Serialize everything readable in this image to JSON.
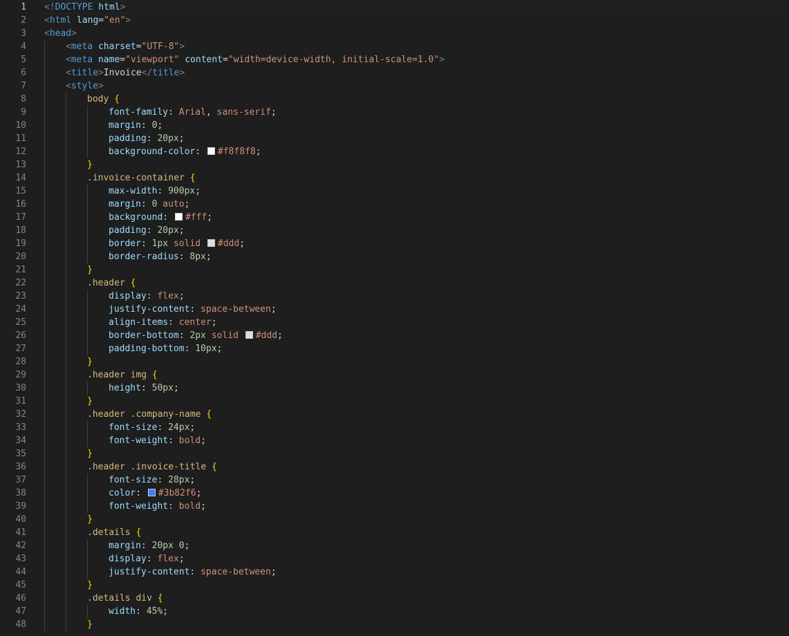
{
  "editor": {
    "current_line": 1,
    "lines": [
      {
        "n": "1",
        "indent": 0,
        "tokens": [
          {
            "t": "<!",
            "c": "punc"
          },
          {
            "t": "DOCTYPE",
            "c": "doctype"
          },
          {
            "t": " html",
            "c": "attr"
          },
          {
            "t": ">",
            "c": "punc"
          }
        ]
      },
      {
        "n": "2",
        "indent": 0,
        "tokens": [
          {
            "t": "<",
            "c": "punc"
          },
          {
            "t": "html",
            "c": "tag"
          },
          {
            "t": " lang",
            "c": "attr"
          },
          {
            "t": "=",
            "c": "plain"
          },
          {
            "t": "\"en\"",
            "c": "str"
          },
          {
            "t": ">",
            "c": "punc"
          }
        ]
      },
      {
        "n": "3",
        "indent": 0,
        "tokens": [
          {
            "t": "<",
            "c": "punc"
          },
          {
            "t": "head",
            "c": "tag"
          },
          {
            "t": ">",
            "c": "punc"
          }
        ]
      },
      {
        "n": "4",
        "indent": 1,
        "tokens": [
          {
            "t": "<",
            "c": "punc"
          },
          {
            "t": "meta",
            "c": "tag"
          },
          {
            "t": " charset",
            "c": "attr"
          },
          {
            "t": "=",
            "c": "plain"
          },
          {
            "t": "\"UTF-8\"",
            "c": "str"
          },
          {
            "t": ">",
            "c": "punc"
          }
        ]
      },
      {
        "n": "5",
        "indent": 1,
        "tokens": [
          {
            "t": "<",
            "c": "punc"
          },
          {
            "t": "meta",
            "c": "tag"
          },
          {
            "t": " name",
            "c": "attr"
          },
          {
            "t": "=",
            "c": "plain"
          },
          {
            "t": "\"viewport\"",
            "c": "str"
          },
          {
            "t": " content",
            "c": "attr"
          },
          {
            "t": "=",
            "c": "plain"
          },
          {
            "t": "\"width=device-width, initial-scale=1.0\"",
            "c": "str"
          },
          {
            "t": ">",
            "c": "punc"
          }
        ]
      },
      {
        "n": "6",
        "indent": 1,
        "tokens": [
          {
            "t": "<",
            "c": "punc"
          },
          {
            "t": "title",
            "c": "tag"
          },
          {
            "t": ">",
            "c": "punc"
          },
          {
            "t": "Invoice",
            "c": "text"
          },
          {
            "t": "</",
            "c": "punc"
          },
          {
            "t": "title",
            "c": "tag"
          },
          {
            "t": ">",
            "c": "punc"
          }
        ]
      },
      {
        "n": "7",
        "indent": 1,
        "tokens": [
          {
            "t": "<",
            "c": "punc"
          },
          {
            "t": "style",
            "c": "tag"
          },
          {
            "t": ">",
            "c": "punc"
          }
        ]
      },
      {
        "n": "8",
        "indent": 2,
        "tokens": [
          {
            "t": "body",
            "c": "sel"
          },
          {
            "t": " ",
            "c": "plain"
          },
          {
            "t": "{",
            "c": "brace"
          }
        ]
      },
      {
        "n": "9",
        "indent": 3,
        "tokens": [
          {
            "t": "font-family",
            "c": "prop"
          },
          {
            "t": ": ",
            "c": "plain"
          },
          {
            "t": "Arial",
            "c": "kw"
          },
          {
            "t": ", ",
            "c": "plain"
          },
          {
            "t": "sans-serif",
            "c": "kw"
          },
          {
            "t": ";",
            "c": "plain"
          }
        ]
      },
      {
        "n": "10",
        "indent": 3,
        "tokens": [
          {
            "t": "margin",
            "c": "prop"
          },
          {
            "t": ": ",
            "c": "plain"
          },
          {
            "t": "0",
            "c": "num"
          },
          {
            "t": ";",
            "c": "plain"
          }
        ]
      },
      {
        "n": "11",
        "indent": 3,
        "tokens": [
          {
            "t": "padding",
            "c": "prop"
          },
          {
            "t": ": ",
            "c": "plain"
          },
          {
            "t": "20px",
            "c": "num"
          },
          {
            "t": ";",
            "c": "plain"
          }
        ]
      },
      {
        "n": "12",
        "indent": 3,
        "tokens": [
          {
            "t": "background-color",
            "c": "prop"
          },
          {
            "t": ": ",
            "c": "plain"
          },
          {
            "swatch": "#f8f8f8"
          },
          {
            "t": "#f8f8f8",
            "c": "kw"
          },
          {
            "t": ";",
            "c": "plain"
          }
        ]
      },
      {
        "n": "13",
        "indent": 2,
        "tokens": [
          {
            "t": "}",
            "c": "brace"
          }
        ]
      },
      {
        "n": "14",
        "indent": 2,
        "tokens": [
          {
            "t": ".invoice-container",
            "c": "sel"
          },
          {
            "t": " ",
            "c": "plain"
          },
          {
            "t": "{",
            "c": "brace"
          }
        ]
      },
      {
        "n": "15",
        "indent": 3,
        "tokens": [
          {
            "t": "max-width",
            "c": "prop"
          },
          {
            "t": ": ",
            "c": "plain"
          },
          {
            "t": "900px",
            "c": "num"
          },
          {
            "t": ";",
            "c": "plain"
          }
        ]
      },
      {
        "n": "16",
        "indent": 3,
        "tokens": [
          {
            "t": "margin",
            "c": "prop"
          },
          {
            "t": ": ",
            "c": "plain"
          },
          {
            "t": "0",
            "c": "num"
          },
          {
            "t": " ",
            "c": "plain"
          },
          {
            "t": "auto",
            "c": "kw"
          },
          {
            "t": ";",
            "c": "plain"
          }
        ]
      },
      {
        "n": "17",
        "indent": 3,
        "tokens": [
          {
            "t": "background",
            "c": "prop"
          },
          {
            "t": ": ",
            "c": "plain"
          },
          {
            "swatch": "#ffffff"
          },
          {
            "t": "#fff",
            "c": "kw"
          },
          {
            "t": ";",
            "c": "plain"
          }
        ]
      },
      {
        "n": "18",
        "indent": 3,
        "tokens": [
          {
            "t": "padding",
            "c": "prop"
          },
          {
            "t": ": ",
            "c": "plain"
          },
          {
            "t": "20px",
            "c": "num"
          },
          {
            "t": ";",
            "c": "plain"
          }
        ]
      },
      {
        "n": "19",
        "indent": 3,
        "tokens": [
          {
            "t": "border",
            "c": "prop"
          },
          {
            "t": ": ",
            "c": "plain"
          },
          {
            "t": "1px",
            "c": "num"
          },
          {
            "t": " ",
            "c": "plain"
          },
          {
            "t": "solid",
            "c": "kw"
          },
          {
            "t": " ",
            "c": "plain"
          },
          {
            "swatch": "#dddddd"
          },
          {
            "t": "#ddd",
            "c": "kw"
          },
          {
            "t": ";",
            "c": "plain"
          }
        ]
      },
      {
        "n": "20",
        "indent": 3,
        "tokens": [
          {
            "t": "border-radius",
            "c": "prop"
          },
          {
            "t": ": ",
            "c": "plain"
          },
          {
            "t": "8px",
            "c": "num"
          },
          {
            "t": ";",
            "c": "plain"
          }
        ]
      },
      {
        "n": "21",
        "indent": 2,
        "tokens": [
          {
            "t": "}",
            "c": "brace"
          }
        ]
      },
      {
        "n": "22",
        "indent": 2,
        "tokens": [
          {
            "t": ".header",
            "c": "sel"
          },
          {
            "t": " ",
            "c": "plain"
          },
          {
            "t": "{",
            "c": "brace"
          }
        ]
      },
      {
        "n": "23",
        "indent": 3,
        "tokens": [
          {
            "t": "display",
            "c": "prop"
          },
          {
            "t": ": ",
            "c": "plain"
          },
          {
            "t": "flex",
            "c": "kw"
          },
          {
            "t": ";",
            "c": "plain"
          }
        ]
      },
      {
        "n": "24",
        "indent": 3,
        "tokens": [
          {
            "t": "justify-content",
            "c": "prop"
          },
          {
            "t": ": ",
            "c": "plain"
          },
          {
            "t": "space-between",
            "c": "kw"
          },
          {
            "t": ";",
            "c": "plain"
          }
        ]
      },
      {
        "n": "25",
        "indent": 3,
        "tokens": [
          {
            "t": "align-items",
            "c": "prop"
          },
          {
            "t": ": ",
            "c": "plain"
          },
          {
            "t": "center",
            "c": "kw"
          },
          {
            "t": ";",
            "c": "plain"
          }
        ]
      },
      {
        "n": "26",
        "indent": 3,
        "tokens": [
          {
            "t": "border-bottom",
            "c": "prop"
          },
          {
            "t": ": ",
            "c": "plain"
          },
          {
            "t": "2px",
            "c": "num"
          },
          {
            "t": " ",
            "c": "plain"
          },
          {
            "t": "solid",
            "c": "kw"
          },
          {
            "t": " ",
            "c": "plain"
          },
          {
            "swatch": "#dddddd"
          },
          {
            "t": "#ddd",
            "c": "kw"
          },
          {
            "t": ";",
            "c": "plain"
          }
        ]
      },
      {
        "n": "27",
        "indent": 3,
        "tokens": [
          {
            "t": "padding-bottom",
            "c": "prop"
          },
          {
            "t": ": ",
            "c": "plain"
          },
          {
            "t": "10px",
            "c": "num"
          },
          {
            "t": ";",
            "c": "plain"
          }
        ]
      },
      {
        "n": "28",
        "indent": 2,
        "tokens": [
          {
            "t": "}",
            "c": "brace"
          }
        ]
      },
      {
        "n": "29",
        "indent": 2,
        "tokens": [
          {
            "t": ".header img",
            "c": "sel"
          },
          {
            "t": " ",
            "c": "plain"
          },
          {
            "t": "{",
            "c": "brace"
          }
        ]
      },
      {
        "n": "30",
        "indent": 3,
        "tokens": [
          {
            "t": "height",
            "c": "prop"
          },
          {
            "t": ": ",
            "c": "plain"
          },
          {
            "t": "50px",
            "c": "num"
          },
          {
            "t": ";",
            "c": "plain"
          }
        ]
      },
      {
        "n": "31",
        "indent": 2,
        "tokens": [
          {
            "t": "}",
            "c": "brace"
          }
        ]
      },
      {
        "n": "32",
        "indent": 2,
        "tokens": [
          {
            "t": ".header .company-name",
            "c": "sel"
          },
          {
            "t": " ",
            "c": "plain"
          },
          {
            "t": "{",
            "c": "brace"
          }
        ]
      },
      {
        "n": "33",
        "indent": 3,
        "tokens": [
          {
            "t": "font-size",
            "c": "prop"
          },
          {
            "t": ": ",
            "c": "plain"
          },
          {
            "t": "24px",
            "c": "num"
          },
          {
            "t": ";",
            "c": "plain"
          }
        ]
      },
      {
        "n": "34",
        "indent": 3,
        "tokens": [
          {
            "t": "font-weight",
            "c": "prop"
          },
          {
            "t": ": ",
            "c": "plain"
          },
          {
            "t": "bold",
            "c": "kw"
          },
          {
            "t": ";",
            "c": "plain"
          }
        ]
      },
      {
        "n": "35",
        "indent": 2,
        "tokens": [
          {
            "t": "}",
            "c": "brace"
          }
        ]
      },
      {
        "n": "36",
        "indent": 2,
        "tokens": [
          {
            "t": ".header .invoice-title",
            "c": "sel"
          },
          {
            "t": " ",
            "c": "plain"
          },
          {
            "t": "{",
            "c": "brace"
          }
        ]
      },
      {
        "n": "37",
        "indent": 3,
        "tokens": [
          {
            "t": "font-size",
            "c": "prop"
          },
          {
            "t": ": ",
            "c": "plain"
          },
          {
            "t": "28px",
            "c": "num"
          },
          {
            "t": ";",
            "c": "plain"
          }
        ]
      },
      {
        "n": "38",
        "indent": 3,
        "tokens": [
          {
            "t": "color",
            "c": "prop"
          },
          {
            "t": ": ",
            "c": "plain"
          },
          {
            "swatch": "#3b82f6"
          },
          {
            "t": "#3b82f6",
            "c": "kw"
          },
          {
            "t": ";",
            "c": "plain"
          }
        ]
      },
      {
        "n": "39",
        "indent": 3,
        "tokens": [
          {
            "t": "font-weight",
            "c": "prop"
          },
          {
            "t": ": ",
            "c": "plain"
          },
          {
            "t": "bold",
            "c": "kw"
          },
          {
            "t": ";",
            "c": "plain"
          }
        ]
      },
      {
        "n": "40",
        "indent": 2,
        "tokens": [
          {
            "t": "}",
            "c": "brace"
          }
        ]
      },
      {
        "n": "41",
        "indent": 2,
        "tokens": [
          {
            "t": ".details",
            "c": "sel"
          },
          {
            "t": " ",
            "c": "plain"
          },
          {
            "t": "{",
            "c": "brace"
          }
        ]
      },
      {
        "n": "42",
        "indent": 3,
        "tokens": [
          {
            "t": "margin",
            "c": "prop"
          },
          {
            "t": ": ",
            "c": "plain"
          },
          {
            "t": "20px",
            "c": "num"
          },
          {
            "t": " ",
            "c": "plain"
          },
          {
            "t": "0",
            "c": "num"
          },
          {
            "t": ";",
            "c": "plain"
          }
        ]
      },
      {
        "n": "43",
        "indent": 3,
        "tokens": [
          {
            "t": "display",
            "c": "prop"
          },
          {
            "t": ": ",
            "c": "plain"
          },
          {
            "t": "flex",
            "c": "kw"
          },
          {
            "t": ";",
            "c": "plain"
          }
        ]
      },
      {
        "n": "44",
        "indent": 3,
        "tokens": [
          {
            "t": "justify-content",
            "c": "prop"
          },
          {
            "t": ": ",
            "c": "plain"
          },
          {
            "t": "space-between",
            "c": "kw"
          },
          {
            "t": ";",
            "c": "plain"
          }
        ]
      },
      {
        "n": "45",
        "indent": 2,
        "tokens": [
          {
            "t": "}",
            "c": "brace"
          }
        ]
      },
      {
        "n": "46",
        "indent": 2,
        "tokens": [
          {
            "t": ".details div",
            "c": "sel"
          },
          {
            "t": " ",
            "c": "plain"
          },
          {
            "t": "{",
            "c": "brace"
          }
        ]
      },
      {
        "n": "47",
        "indent": 3,
        "tokens": [
          {
            "t": "width",
            "c": "prop"
          },
          {
            "t": ": ",
            "c": "plain"
          },
          {
            "t": "45%",
            "c": "num"
          },
          {
            "t": ";",
            "c": "plain"
          }
        ]
      },
      {
        "n": "48",
        "indent": 2,
        "tokens": [
          {
            "t": "}",
            "c": "brace"
          }
        ]
      }
    ]
  }
}
